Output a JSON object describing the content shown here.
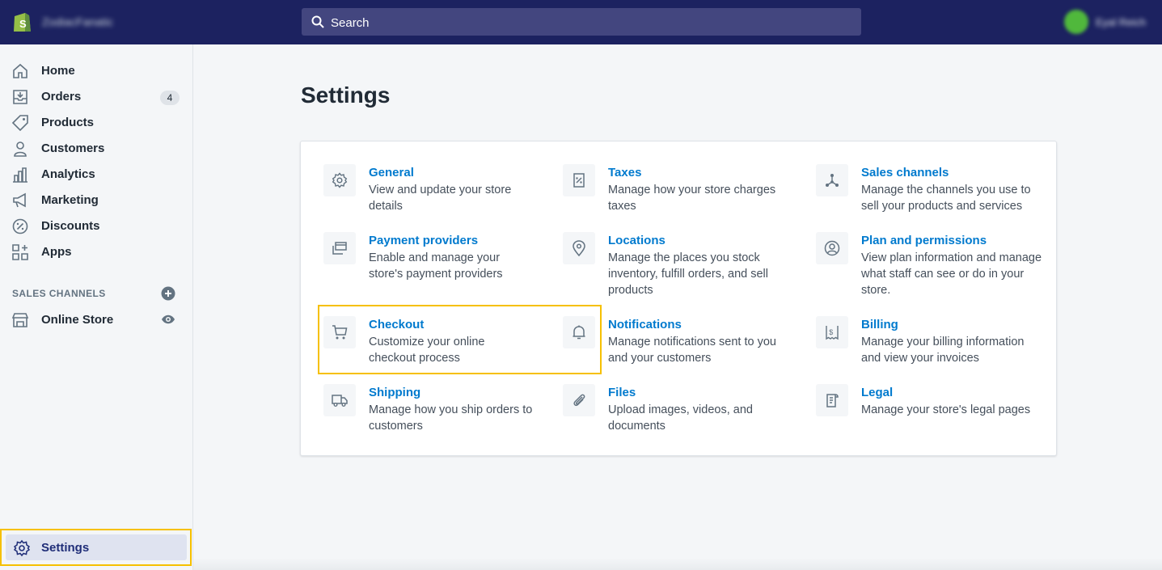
{
  "topbar": {
    "store_name": "ZodiacFanatic",
    "search_placeholder": "Search",
    "user_name": "Eyal Reich",
    "accent_color": "#1c2260"
  },
  "sidebar": {
    "items": [
      {
        "label": "Home",
        "icon": "home-icon"
      },
      {
        "label": "Orders",
        "icon": "orders-icon",
        "badge": "4"
      },
      {
        "label": "Products",
        "icon": "tag-icon"
      },
      {
        "label": "Customers",
        "icon": "person-icon"
      },
      {
        "label": "Analytics",
        "icon": "bar-chart-icon"
      },
      {
        "label": "Marketing",
        "icon": "megaphone-icon"
      },
      {
        "label": "Discounts",
        "icon": "discount-icon"
      },
      {
        "label": "Apps",
        "icon": "apps-icon"
      }
    ],
    "sales_channels_title": "SALES CHANNELS",
    "channels": [
      {
        "label": "Online Store",
        "icon": "store-icon"
      }
    ],
    "settings_label": "Settings"
  },
  "main": {
    "title": "Settings",
    "tiles": [
      {
        "title": "General",
        "desc": "View and update your store details",
        "icon": "gear-icon"
      },
      {
        "title": "Taxes",
        "desc": "Manage how your store charges taxes",
        "icon": "tax-icon"
      },
      {
        "title": "Sales channels",
        "desc": "Manage the channels you use to sell your products and services",
        "icon": "channels-icon"
      },
      {
        "title": "Payment providers",
        "desc": "Enable and manage your store's payment providers",
        "icon": "payment-icon"
      },
      {
        "title": "Locations",
        "desc": "Manage the places you stock inventory, fulfill orders, and sell products",
        "icon": "location-pin-icon"
      },
      {
        "title": "Plan and permissions",
        "desc": "View plan information and manage what staff can see or do in your store.",
        "icon": "account-icon"
      },
      {
        "title": "Checkout",
        "desc": "Customize your online checkout process",
        "icon": "cart-icon"
      },
      {
        "title": "Notifications",
        "desc": "Manage notifications sent to you and your customers",
        "icon": "bell-icon"
      },
      {
        "title": "Billing",
        "desc": "Manage your billing information and view your invoices",
        "icon": "billing-icon"
      },
      {
        "title": "Shipping",
        "desc": "Manage how you ship orders to customers",
        "icon": "truck-icon"
      },
      {
        "title": "Files",
        "desc": "Upload images, videos, and documents",
        "icon": "paperclip-icon"
      },
      {
        "title": "Legal",
        "desc": "Manage your store's legal pages",
        "icon": "legal-icon"
      }
    ],
    "link_color": "#007ace",
    "highlight_color": "#f6c000"
  }
}
